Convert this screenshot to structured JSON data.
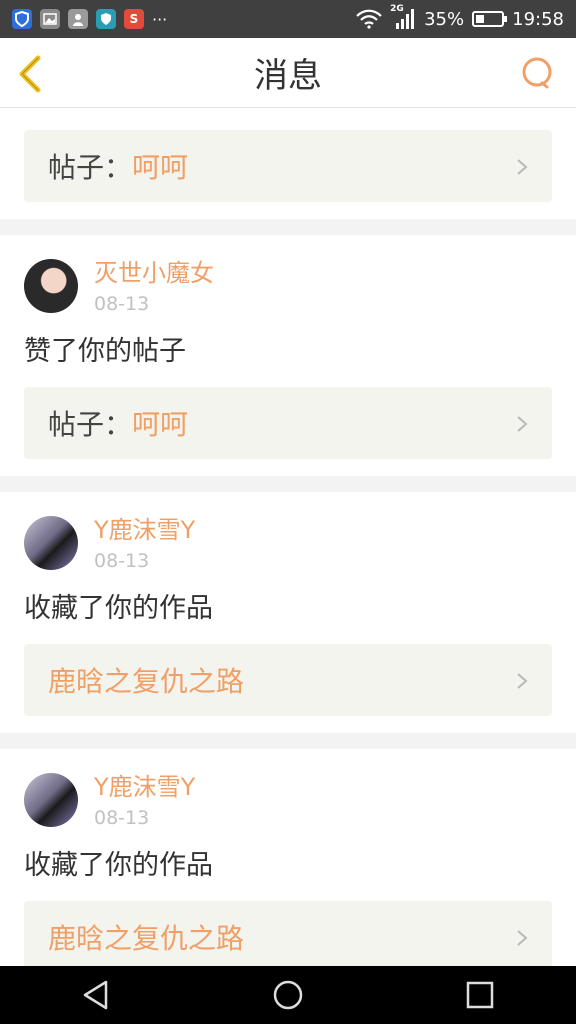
{
  "status_bar": {
    "icons": [
      "shield-icon",
      "image-icon",
      "contact-icon",
      "security-icon",
      "app-s-icon"
    ],
    "more": "···",
    "network": "2G",
    "battery": "35%",
    "battery_level": 0.35,
    "time": "19:58"
  },
  "header": {
    "title": "消息"
  },
  "partial_card": {
    "ref_prefix": "帖子：",
    "ref_value": "呵呵"
  },
  "notifications": [
    {
      "user": "灭世小魔女",
      "date": "08-13",
      "action": "赞了你的帖子",
      "ref_prefix": "帖子：",
      "ref_value": "呵呵"
    },
    {
      "user": "Y鹿沫雪Y",
      "date": "08-13",
      "action": "收藏了你的作品",
      "ref_prefix": "",
      "ref_value": "鹿晗之复仇之路"
    },
    {
      "user": "Y鹿沫雪Y",
      "date": "08-13",
      "action": "收藏了你的作品",
      "ref_prefix": "",
      "ref_value": "鹿晗之复仇之路"
    }
  ],
  "colors": {
    "accent": "#f0a067",
    "back": "#f0c020"
  }
}
